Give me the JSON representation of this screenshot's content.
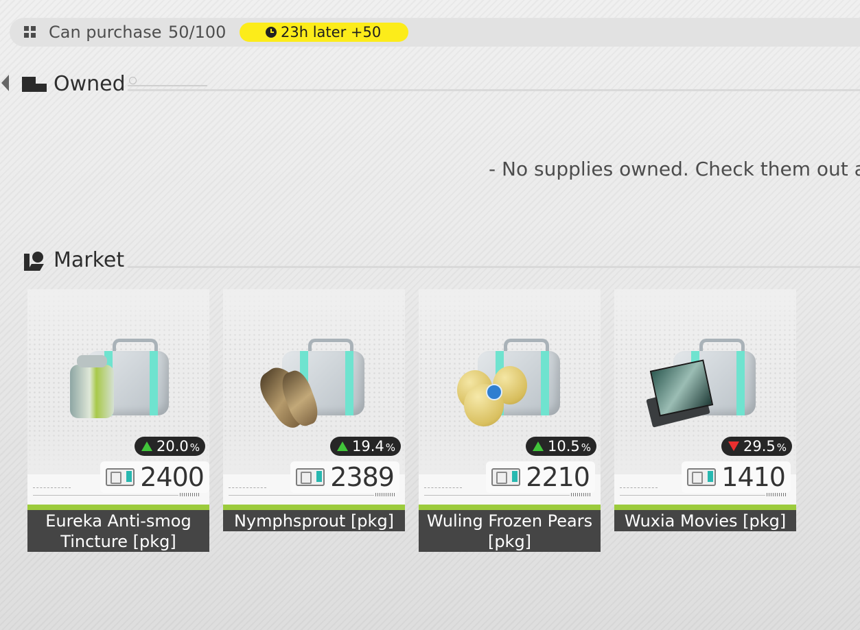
{
  "purchase_bar": {
    "label": "Can purchase",
    "count": "50/100",
    "timer": "23h later +50",
    "timer_color": "#fcec1a"
  },
  "owned": {
    "title": "Owned",
    "empty_message": "- No supplies owned. Check them out at t"
  },
  "market": {
    "title": "Market",
    "items": [
      {
        "name": "Eureka Anti-smog Tincture [pkg]",
        "price": "2400",
        "change": "20.0",
        "pct": "%",
        "trend": "up",
        "item_icon": "tincture-can-icon"
      },
      {
        "name": "Nymphsprout [pkg]",
        "price": "2389",
        "change": "19.4",
        "pct": "%",
        "trend": "up",
        "item_icon": "bamboo-shoot-icon"
      },
      {
        "name": "Wuling Frozen Pears [pkg]",
        "price": "2210",
        "change": "10.5",
        "pct": "%",
        "trend": "up",
        "item_icon": "pears-icon"
      },
      {
        "name": "Wuxia Movies [pkg]",
        "price": "1410",
        "change": "29.5",
        "pct": "%",
        "trend": "down",
        "item_icon": "movie-cassettes-icon"
      }
    ]
  },
  "colors": {
    "up": "#41c53a",
    "down": "#ea2f2f",
    "accent_bar": "#9ccb3c"
  }
}
